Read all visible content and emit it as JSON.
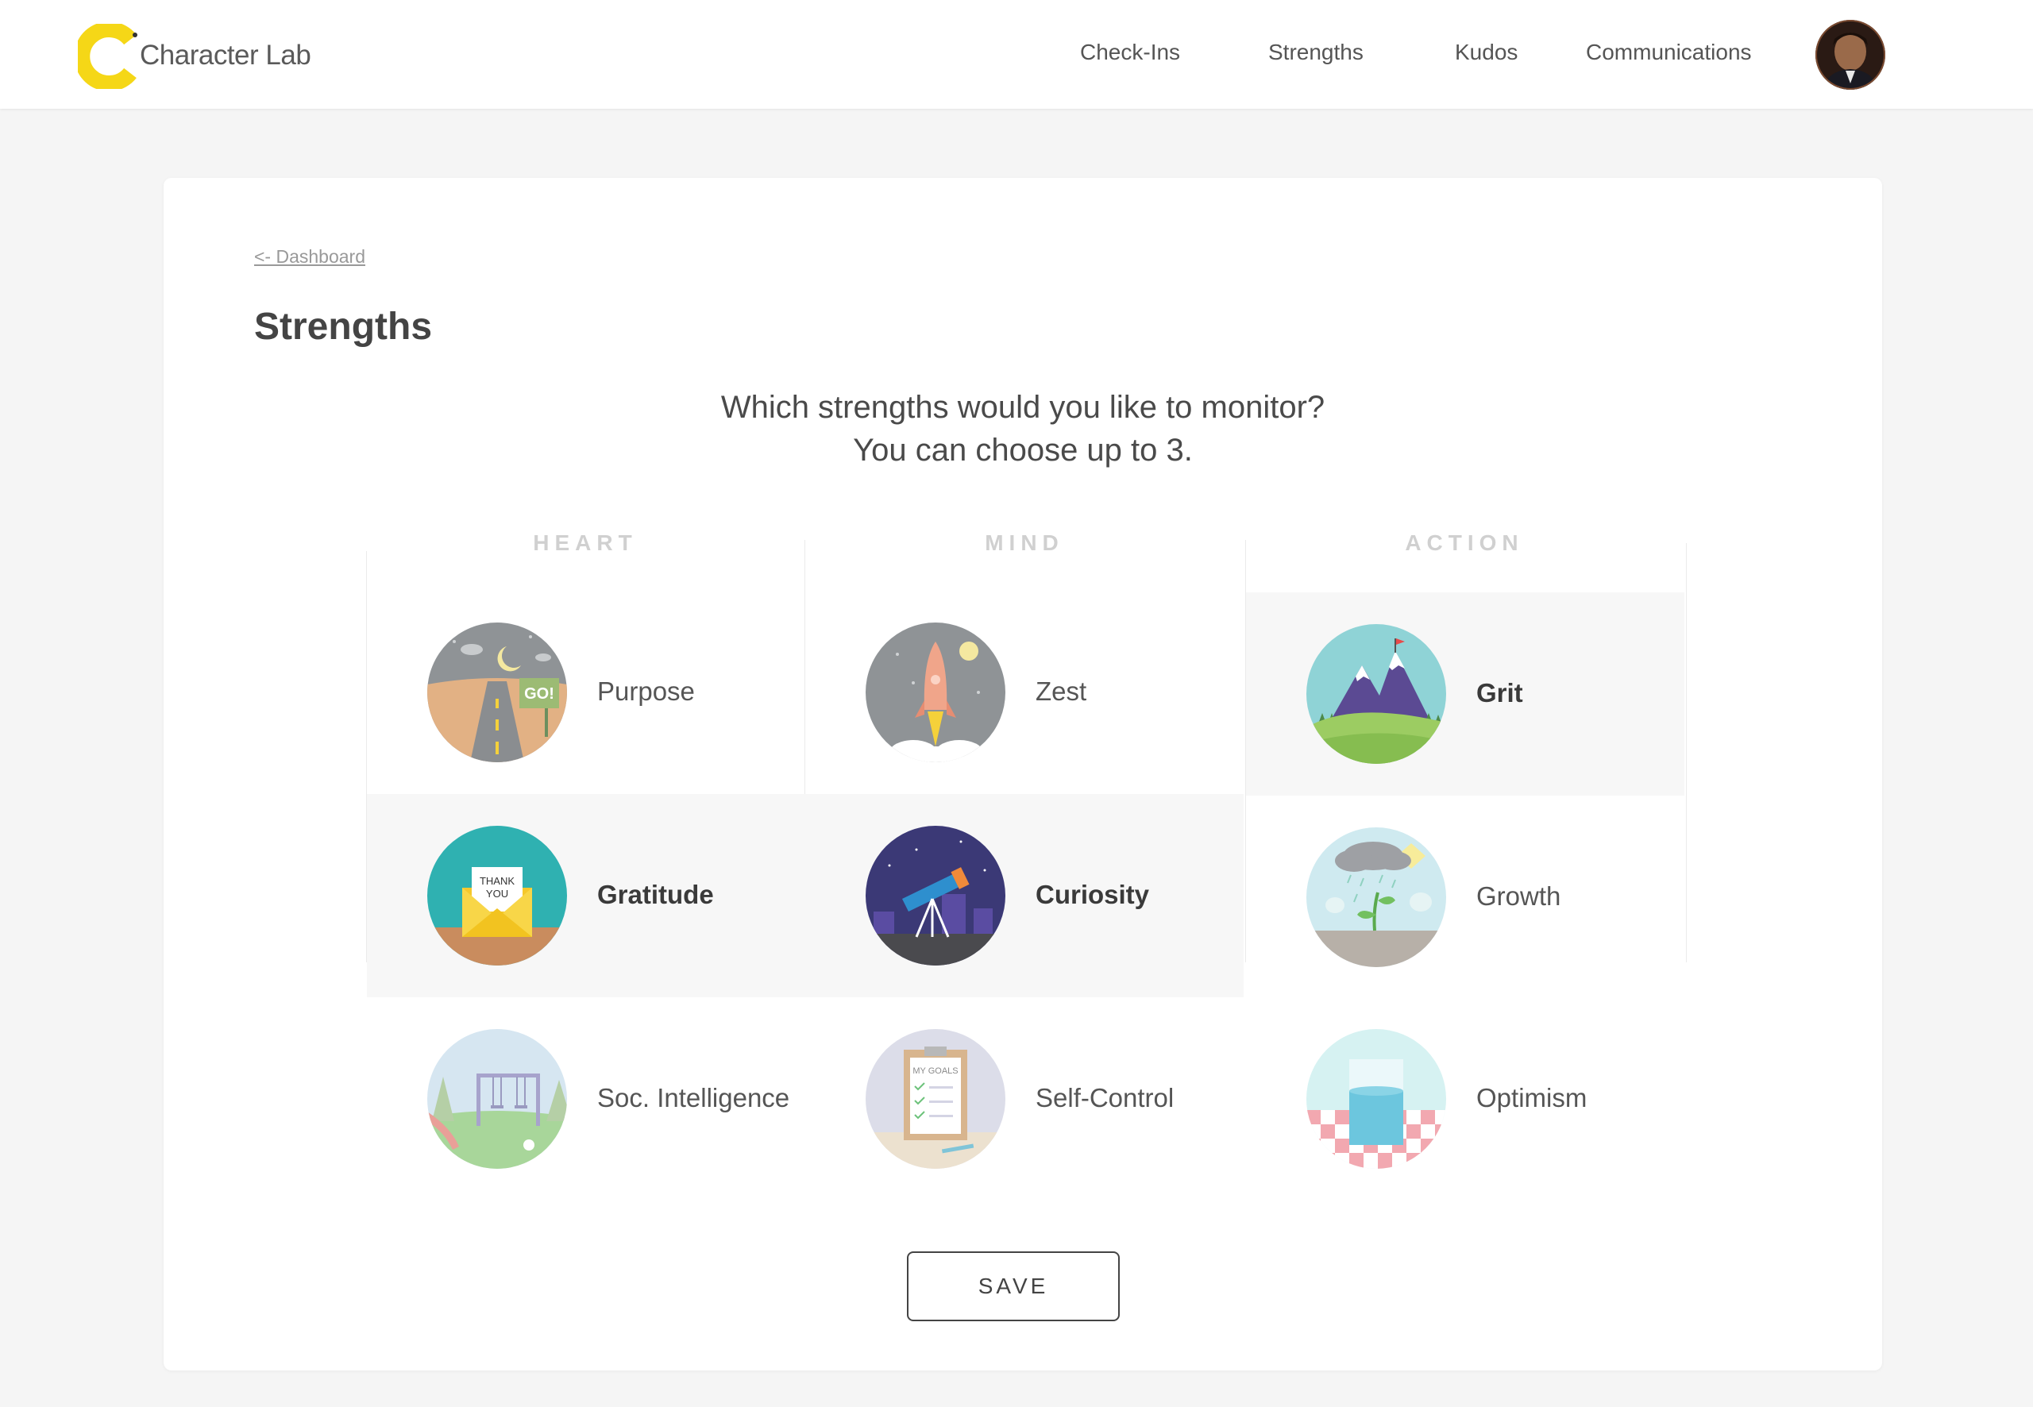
{
  "header": {
    "logo_text": "Character Lab",
    "nav": [
      "Check-Ins",
      "Strengths",
      "Kudos",
      "Communications"
    ]
  },
  "page": {
    "back_link": "<- Dashboard",
    "title": "Strengths",
    "prompt_line1": "Which strengths would you like to monitor?",
    "prompt_line2": "You can choose up to 3."
  },
  "columns": [
    {
      "header": "HEART",
      "items": [
        {
          "label": "Purpose",
          "selected": false,
          "icon": "road-sign-illustration"
        },
        {
          "label": "Gratitude",
          "selected": true,
          "icon": "thank-you-envelope-illustration",
          "envelope_text": "THANK YOU"
        },
        {
          "label": "Soc. Intelligence",
          "selected": false,
          "icon": "playground-swing-illustration"
        }
      ]
    },
    {
      "header": "MIND",
      "items": [
        {
          "label": "Zest",
          "selected": false,
          "icon": "rocket-illustration"
        },
        {
          "label": "Curiosity",
          "selected": true,
          "icon": "telescope-illustration"
        },
        {
          "label": "Self-Control",
          "selected": false,
          "icon": "goals-clipboard-illustration",
          "clipboard_text": "MY GOALS"
        }
      ]
    },
    {
      "header": "ACTION",
      "items": [
        {
          "label": "Grit",
          "selected": true,
          "icon": "mountain-illustration"
        },
        {
          "label": "Growth",
          "selected": false,
          "icon": "sprout-rain-illustration"
        },
        {
          "label": "Optimism",
          "selected": false,
          "icon": "glass-of-water-illustration"
        }
      ]
    }
  ],
  "purpose_sign_text": "GO!",
  "save_label": "SAVE",
  "colors": {
    "logo_yellow": "#f5d717",
    "selected_bg": "#f7f7f7",
    "column_header": "#d0d0d0"
  }
}
